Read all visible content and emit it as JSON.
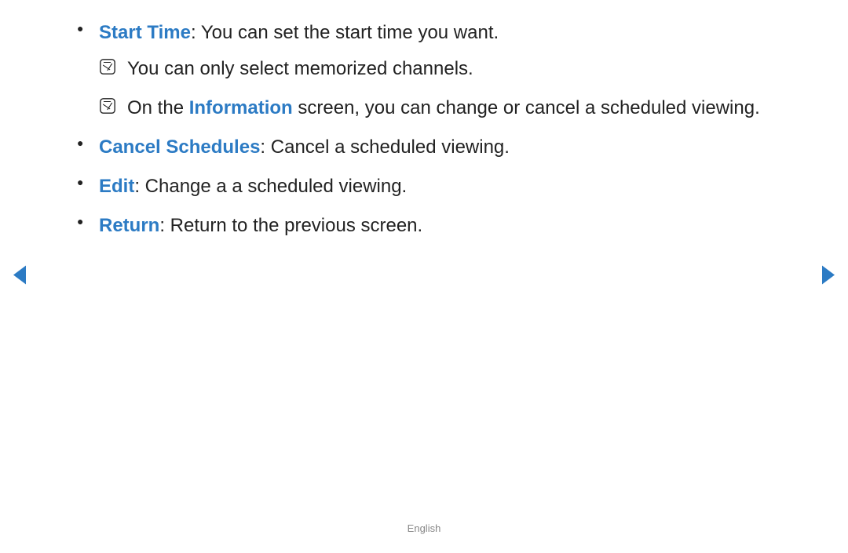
{
  "items": [
    {
      "term": "Start Time",
      "desc": ": You can set the start time you want.",
      "notes": [
        {
          "text": "You can only select memorized channels."
        },
        {
          "pre": "On the ",
          "mid": "Information",
          "post": " screen, you can change or cancel a scheduled viewing."
        }
      ]
    },
    {
      "term": "Cancel Schedules",
      "desc": ": Cancel a scheduled viewing."
    },
    {
      "term": "Edit",
      "desc": ": Change a a scheduled viewing."
    },
    {
      "term": "Return",
      "desc": ": Return to the previous screen."
    }
  ],
  "footer": "English"
}
